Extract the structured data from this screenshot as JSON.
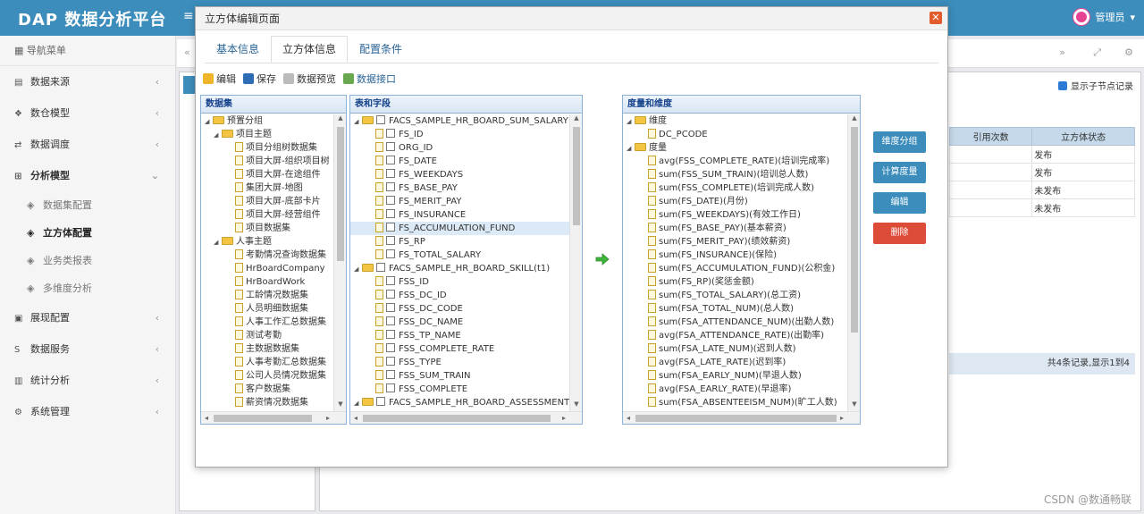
{
  "app": {
    "title": "DAP 数据分析平台",
    "user": "管理员"
  },
  "sidebar": {
    "header": "导航菜单",
    "items": [
      {
        "label": "数据来源",
        "icon": "database-icon"
      },
      {
        "label": "数仓模型",
        "icon": "cubes-icon"
      },
      {
        "label": "数据调度",
        "icon": "shuffle-icon"
      },
      {
        "label": "分析模型",
        "icon": "sitemap-icon"
      },
      {
        "label": "展现配置",
        "icon": "film-icon"
      },
      {
        "label": "数据服务",
        "icon": "s-icon"
      },
      {
        "label": "统计分析",
        "icon": "bar-chart-icon"
      },
      {
        "label": "系统管理",
        "icon": "gear-icon"
      }
    ],
    "sub_items": [
      "数据集配置",
      "立方体配置",
      "业务类报表",
      "多维度分析"
    ]
  },
  "background": {
    "show_child_label": "显示子节点记录",
    "table_headers": [
      "引用次数",
      "立方体状态"
    ],
    "table_rows": [
      "发布",
      "发布",
      "未发布",
      "未发布"
    ],
    "footer": "共4条记录,显示1到4"
  },
  "modal": {
    "title": "立方体编辑页面",
    "tabs": [
      "基本信息",
      "立方体信息",
      "配置条件"
    ],
    "toolbar": {
      "edit": "编辑",
      "save": "保存",
      "preview": "数据预览",
      "api": "数据接口"
    },
    "datasets": {
      "header": "数据集",
      "groups": [
        {
          "label": "预置分组",
          "sub": "项目主题",
          "items": [
            "项目分组树数据集",
            "项目大屏-组织项目树",
            "项目大屏-在途组件",
            "集团大屏-地图",
            "项目大屏-底部卡片",
            "项目大屏-经营组件",
            "项目数据集"
          ]
        },
        {
          "label": "人事主题",
          "items": [
            "考勤情况查询数据集",
            "HrBoardCompany",
            "HrBoardWork",
            "工龄情况数据集",
            "人员明细数据集",
            "人事工作汇总数据集",
            "测试考勤",
            "主数据数据集",
            "人事考勤汇总数据集",
            "公司人员情况数据集",
            "客户数据集",
            "薪资情况数据集"
          ]
        }
      ]
    },
    "tables": {
      "header": "表和字段",
      "groups": [
        {
          "label": "FACS_SAMPLE_HR_BOARD_SUM_SALARY",
          "fields": [
            "FS_ID",
            "ORG_ID",
            "FS_DATE",
            "FS_WEEKDAYS",
            "FS_BASE_PAY",
            "FS_MERIT_PAY",
            "FS_INSURANCE",
            "FS_ACCUMULATION_FUND",
            "FS_RP",
            "FS_TOTAL_SALARY"
          ]
        },
        {
          "label": "FACS_SAMPLE_HR_BOARD_SKILL(t1)",
          "fields": [
            "FSS_ID",
            "FSS_DC_ID",
            "FSS_DC_CODE",
            "FSS_DC_NAME",
            "FSS_TP_NAME",
            "FSS_COMPLETE_RATE",
            "FSS_TYPE",
            "FSS_SUM_TRAIN",
            "FSS_COMPLETE"
          ]
        },
        {
          "label": "FACS_SAMPLE_HR_BOARD_ASSESSMENT",
          "fields": []
        }
      ]
    },
    "measures": {
      "header": "度量和维度",
      "dim_label": "维度",
      "dims": [
        "DC_PCODE"
      ],
      "measure_label": "度量",
      "items": [
        "avg(FSS_COMPLETE_RATE)(培训完成率)",
        "sum(FSS_SUM_TRAIN)(培训总人数)",
        "sum(FSS_COMPLETE)(培训完成人数)",
        "sum(FS_DATE)(月份)",
        "sum(FS_WEEKDAYS)(有效工作日)",
        "sum(FS_BASE_PAY)(基本薪资)",
        "sum(FS_MERIT_PAY)(绩效薪资)",
        "sum(FS_INSURANCE)(保险)",
        "sum(FS_ACCUMULATION_FUND)(公积金)",
        "sum(FS_RP)(奖惩金额)",
        "sum(FS_TOTAL_SALARY)(总工资)",
        "sum(FSA_TOTAL_NUM)(总人数)",
        "sum(FSA_ATTENDANCE_NUM)(出勤人数)",
        "avg(FSA_ATTENDANCE_RATE)(出勤率)",
        "sum(FSA_LATE_NUM)(迟到人数)",
        "avg(FSA_LATE_RATE)(迟到率)",
        "sum(FSA_EARLY_NUM)(早退人数)",
        "avg(FSA_EARLY_RATE)(早退率)",
        "sum(FSA_ABSENTEEISM_NUM)(旷工人数)"
      ]
    },
    "buttons": {
      "dim_group": "维度分组",
      "calc_measure": "计算度量",
      "edit": "编辑",
      "delete": "删除"
    }
  },
  "watermark": "CSDN @数通畅联"
}
